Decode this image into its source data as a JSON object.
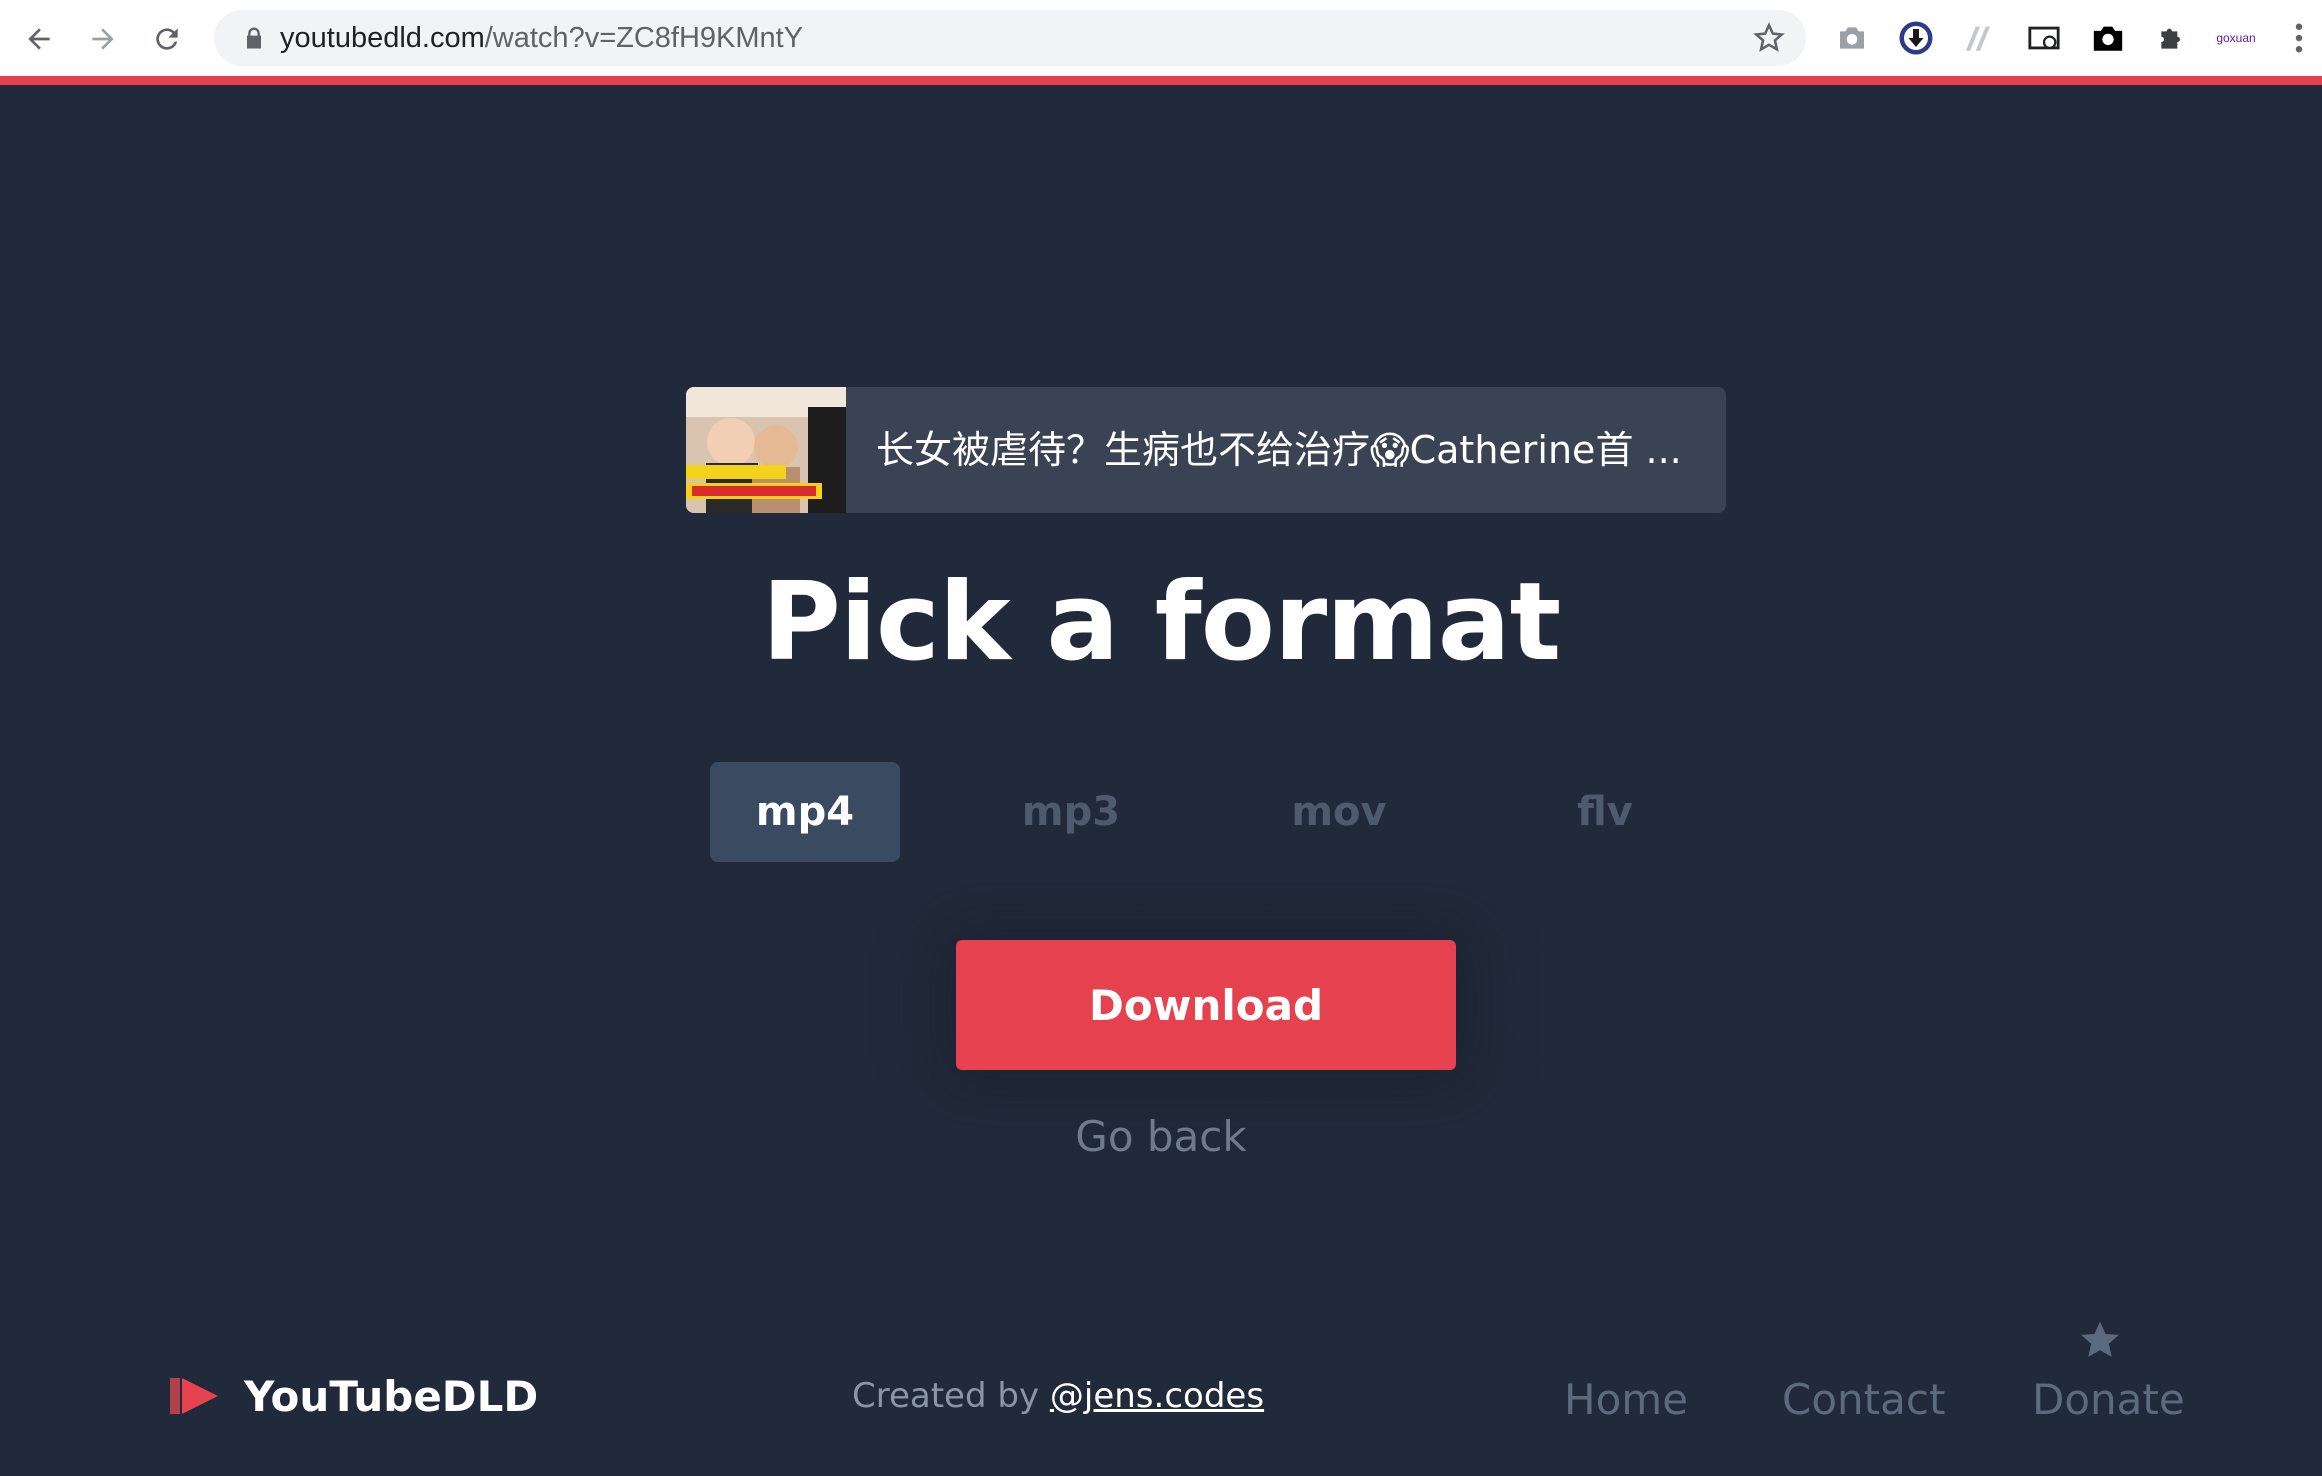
{
  "browser": {
    "url_domain": "youtubedld.com",
    "url_path": "/watch?v=ZC8fH9KMntY",
    "extension_text": "goxuan"
  },
  "video": {
    "title": "长女被虐待？生病也不给治疗😱Catherine首 ..."
  },
  "main": {
    "heading": "Pick a format",
    "formats": [
      "mp4",
      "mp3",
      "mov",
      "flv"
    ],
    "selected_format": "mp4",
    "download_label": "Download",
    "back_label": "Go back"
  },
  "footer": {
    "brand": "YouTubeDLD",
    "credit_prefix": "Created by",
    "credit_link": "@jens.codes",
    "nav": [
      "Home",
      "Contact",
      "Donate"
    ]
  },
  "colors": {
    "background": "#212a3a",
    "accent": "#e5414f",
    "active_tab": "#3a4a60"
  }
}
